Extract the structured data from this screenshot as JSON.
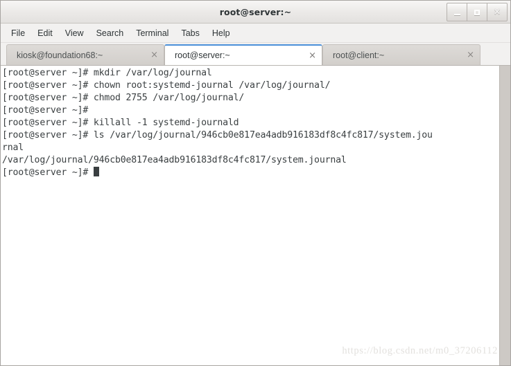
{
  "window": {
    "title": "root@server:~",
    "controls": [
      {
        "name": "minimize",
        "glyph": "_"
      },
      {
        "name": "maximize",
        "glyph": "□"
      },
      {
        "name": "close",
        "glyph": "×"
      }
    ]
  },
  "menubar": {
    "items": [
      {
        "label": "File"
      },
      {
        "label": "Edit"
      },
      {
        "label": "View"
      },
      {
        "label": "Search"
      },
      {
        "label": "Terminal"
      },
      {
        "label": "Tabs"
      },
      {
        "label": "Help"
      }
    ]
  },
  "tabs": [
    {
      "label": "kiosk@foundation68:~",
      "active": false,
      "close": "×"
    },
    {
      "label": "root@server:~",
      "active": true,
      "close": "×"
    },
    {
      "label": "root@client:~",
      "active": false,
      "close": "×"
    }
  ],
  "terminal": {
    "prompt": "[root@server ~]#",
    "foreground": "#3a3f41",
    "background": "#ffffff",
    "lines": [
      "[root@server ~]# mkdir /var/log/journal",
      "[root@server ~]# chown root:systemd-journal /var/log/journal/",
      "[root@server ~]# chmod 2755 /var/log/journal/",
      "[root@server ~]#",
      "[root@server ~]# killall -1 systemd-journald",
      "[root@server ~]# ls /var/log/journal/946cb0e817ea4adb916183df8c4fc817/system.jou",
      "rnal",
      "/var/log/journal/946cb0e817ea4adb916183df8c4fc817/system.journal",
      "[root@server ~]# "
    ],
    "cursor_line_index": 8
  },
  "watermark": {
    "text": "https://blog.csdn.net/m0_37206112"
  },
  "colors": {
    "accent": "#4a90d9",
    "chrome": "#f2f1f0",
    "tab_inactive": "#d6d3cf",
    "text": "#2e3436"
  }
}
